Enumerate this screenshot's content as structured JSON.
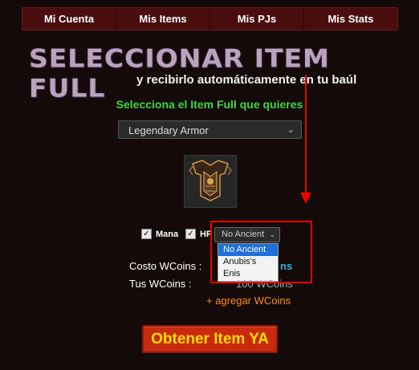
{
  "nav": {
    "items": [
      "Mi Cuenta",
      "Mis Items",
      "Mis PJs",
      "Mis Stats"
    ]
  },
  "banner": {
    "title": "SELECCIONAR ITEM FULL",
    "subtitle": "y recibirlo automáticamente en tu baúl"
  },
  "prompt": "Selecciona el Item Full que quieres",
  "item_select": {
    "value": "Legendary Armor"
  },
  "item_image": {
    "icon": "legendary-armor-icon"
  },
  "options": {
    "mana_label": "Mana",
    "hp_label": "HP",
    "mana_checked": true,
    "hp_checked": true
  },
  "ancient_select": {
    "value": "No Ancient",
    "options": [
      "No Ancient",
      "Anubis's",
      "Enis"
    ]
  },
  "costs": {
    "costo_label": "Costo WCoins :",
    "tus_label": "Tus WCoins :",
    "costo_value_visible": "ns",
    "tus_value_visible": "100 WCoins"
  },
  "add_link": "+ agregar WCoins",
  "submit": "Obtener Item YA",
  "colors": {
    "accent_red": "#e00000",
    "prompt_green": "#3fd43f",
    "link_orange": "#ff8c1a",
    "cyan": "#28b6d2"
  }
}
